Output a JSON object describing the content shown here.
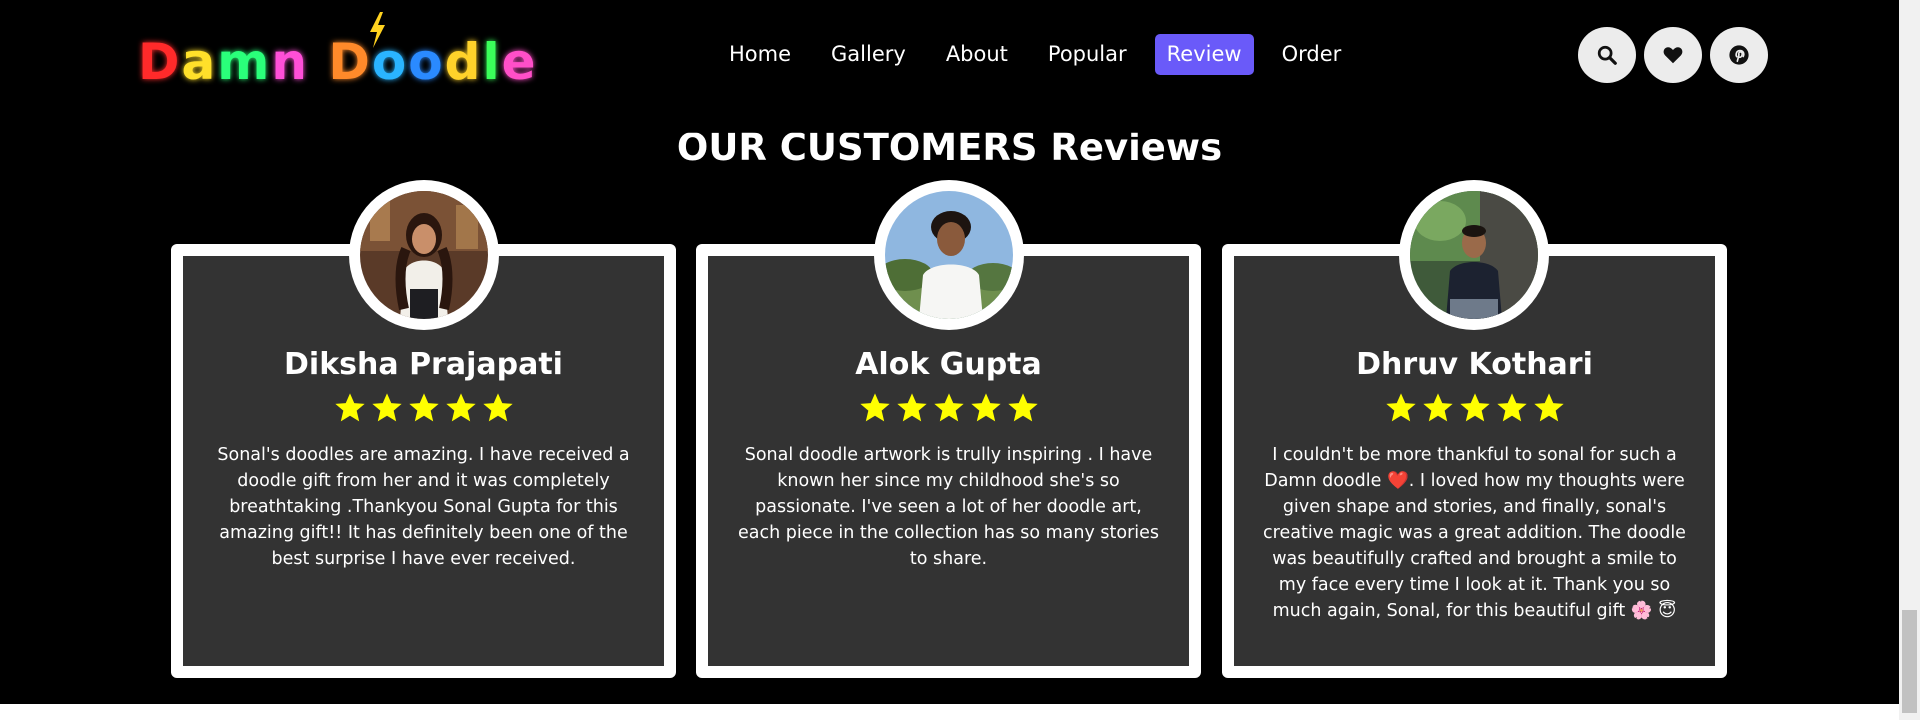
{
  "brand": {
    "logo_letters": [
      "D",
      "a",
      "m",
      "n",
      " ",
      "D",
      "o",
      "o",
      "d",
      "l",
      "e"
    ],
    "logo_colors": [
      "#ff2a2a",
      "#ffe02a",
      "#2aff7a",
      "#ff4fd8",
      "#000000",
      "#ff8a2a",
      "#2ab4ff",
      "#2a8aff",
      "#ffd22a",
      "#3aff5a",
      "#ff4fc8"
    ],
    "bolt_color": "#ffd21f"
  },
  "nav": {
    "items": [
      "Home",
      "Gallery",
      "About",
      "Popular",
      "Review",
      "Order"
    ],
    "active": "Review",
    "active_color": "#6a5af9"
  },
  "header_icons": [
    "search-icon",
    "heart-icon",
    "pinterest-icon"
  ],
  "section": {
    "title": "OUR CUSTOMERS Reviews"
  },
  "reviews": [
    {
      "name": "Diksha Prajapati",
      "rating": 5,
      "text": "Sonal's doodles are amazing. I have received a doodle gift from her and it was completely breathtaking .Thankyou Sonal Gupta for this amazing gift!! It has definitely been one of the best surprise I have ever received."
    },
    {
      "name": "Alok Gupta",
      "rating": 5,
      "text": "Sonal doodle artwork is trully inspiring . I have known her since my childhood she's so passionate. I've seen a lot of her doodle art, each piece in the collection has so many stories to share."
    },
    {
      "name": "Dhruv Kothari",
      "rating": 5,
      "text_before": "I couldn't be more thankful to sonal for such a Damn doodle ",
      "emoji_heart": "❤️",
      "text_after": ". I loved how my thoughts were given shape and stories, and finally, sonal's creative magic was a great addition. The doodle was beautifully crafted and brought a smile to my face every time I look at it. Thank you so much again, Sonal, for this beautiful gift ",
      "emoji_end": "🌸 😇"
    }
  ],
  "colors": {
    "background": "#000000",
    "card_border": "#ffffff",
    "card_fill": "#333333",
    "star": "#ffff00"
  }
}
